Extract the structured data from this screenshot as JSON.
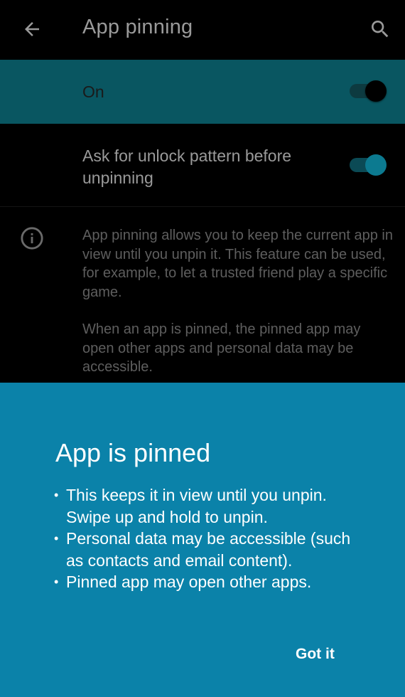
{
  "app_bar": {
    "title": "App pinning",
    "back_icon": "arrow-back-icon",
    "search_icon": "search-icon"
  },
  "master_switch": {
    "label": "On",
    "checked": true
  },
  "unlock_setting": {
    "label": "Ask for unlock pattern before unpinning",
    "checked": true
  },
  "info": {
    "icon": "info-icon",
    "paragraph_1": "App pinning allows you to keep the current app in view until you unpin it. This feature can be used, for example, to let a trusted friend play a specific game.",
    "paragraph_2": "When an app is pinned, the pinned app may open other apps and personal data may be accessible."
  },
  "pinned_sheet": {
    "title": "App is pinned",
    "bullets": [
      "This keeps it in view until you unpin. Swipe up and hold to unpin.",
      "Personal data may be accessible (such as contacts and email content).",
      "Pinned app may open other apps."
    ],
    "confirm_label": "Got it"
  },
  "colors": {
    "background": "#000000",
    "master_row": "#095661",
    "sheet": "#0b82a9",
    "accent": "#0c7a90"
  }
}
